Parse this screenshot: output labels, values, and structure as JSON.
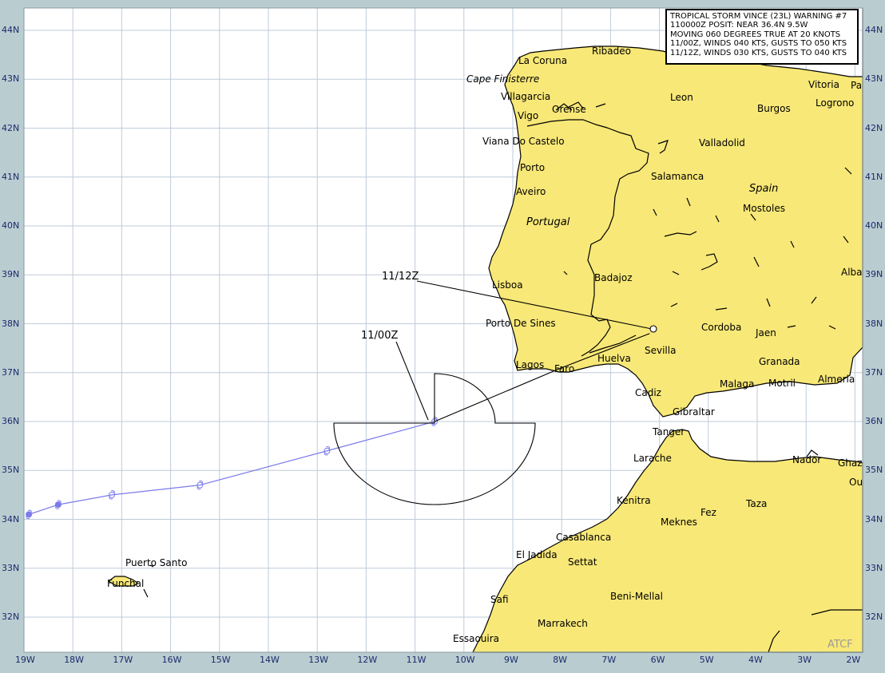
{
  "bulletin": {
    "title": "TROPICAL STORM VINCE (23L) WARNING #7",
    "lines": [
      "110000Z POSIT: NEAR 36.4N  9.5W",
      "MOVING 060 DEGREES TRUE AT 20 KNOTS",
      "11/00Z, WINDS 040 KTS, GUSTS TO 050 KTS",
      "11/12Z, WINDS 030 KTS, GUSTS TO 040 KTS"
    ]
  },
  "watermark": "ATCF",
  "lat_labels": [
    "44N",
    "43N",
    "42N",
    "41N",
    "40N",
    "39N",
    "38N",
    "37N",
    "36N",
    "35N",
    "34N",
    "33N",
    "32N"
  ],
  "lon_labels": [
    "19W",
    "18W",
    "17W",
    "16W",
    "15W",
    "14W",
    "13W",
    "12W",
    "11W",
    "10W",
    "9W",
    "8W",
    "7W",
    "6W",
    "5W",
    "4W",
    "3W",
    "2W"
  ],
  "forecast_labels": {
    "f1": "11/00Z",
    "f2": "11/12Z"
  },
  "countries": {
    "spain": "Spain",
    "portugal": "Portugal"
  },
  "capes": {
    "finisterre": "Cape Finisterre"
  },
  "places": {
    "la_coruna": "La Coruna",
    "ribadeo": "Ribadeo",
    "villagarcia": "Villagarcia",
    "vigo": "Vigo",
    "orense": "Orense",
    "leon": "Leon",
    "burgos": "Burgos",
    "vitoria": "Vitoria",
    "pa": "Pa",
    "logrono": "Logrono",
    "viana": "Viana Do Castelo",
    "valladolid": "Valladolid",
    "porto": "Porto",
    "salamanca": "Salamanca",
    "aveiro": "Aveiro",
    "mostoles": "Mostoles",
    "badajoz": "Badajoz",
    "lisboa": "Lisboa",
    "alba": "Alba",
    "porto_sines": "Porto De Sines",
    "cordoba": "Cordoba",
    "jaen": "Jaen",
    "sevilla": "Sevilla",
    "huelva": "Huelva",
    "granada": "Granada",
    "lagos": "Lagos",
    "faro": "Faro",
    "almeria": "Almeria",
    "malaga": "Malaga",
    "motril": "Motril",
    "cadiz": "Cadiz",
    "gibraltar": "Gibraltar",
    "tanger": "Tanger",
    "larache": "Larache",
    "nador": "Nador",
    "ghaz": "Ghaz",
    "ou": "Ou",
    "kenitra": "Kenitra",
    "fez": "Fez",
    "taza": "Taza",
    "meknes": "Meknes",
    "casablanca": "Casablanca",
    "el_jadida": "El Jadida",
    "settat": "Settat",
    "puerto_santo": "Puerto Santo",
    "funchal": "Funchal",
    "beni_mellal": "Beni-Mellal",
    "safi": "Safi",
    "marrakech": "Marrakech",
    "essaouira": "Essaouira"
  },
  "colors": {
    "land": "#f8e877",
    "ocean": "#ffffff",
    "grid": "#bfcbd8",
    "frame": "#b9cdd1",
    "track": "#7b7bea",
    "forecast": "#000000",
    "label": "#1a2a6a"
  },
  "track_points": [
    {
      "lat": 34.1,
      "lon": -18.9
    },
    {
      "lat": 34.3,
      "lon": -18.3
    },
    {
      "lat": 34.5,
      "lon": -17.2
    },
    {
      "lat": 34.7,
      "lon": -15.4
    },
    {
      "lat": 35.4,
      "lon": -12.8
    },
    {
      "lat": 36.0,
      "lon": -10.6
    }
  ],
  "forecast_track": [
    {
      "lat": 36.0,
      "lon": -10.6
    },
    {
      "lat": 37.1,
      "lon": -8.0
    },
    {
      "lat": 37.8,
      "lon": -6.2
    }
  ]
}
